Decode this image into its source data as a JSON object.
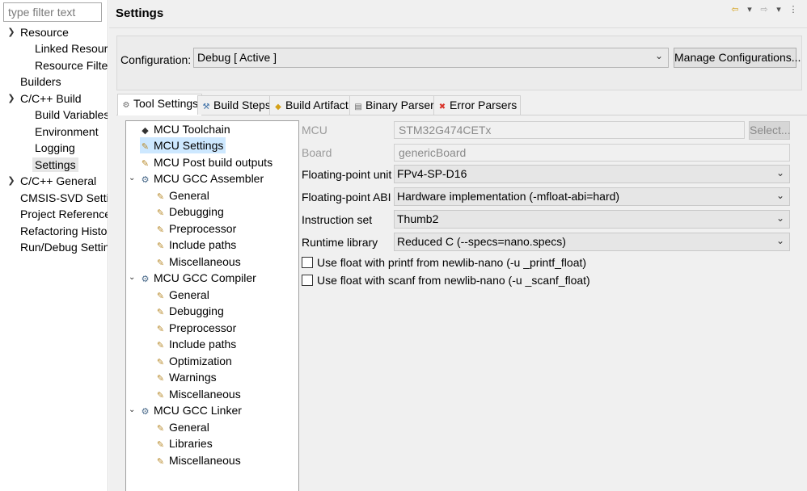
{
  "left_nav": {
    "filter_placeholder": "type filter text",
    "items": [
      {
        "label": "Resource",
        "expanded": true
      },
      {
        "label": "Linked Resources"
      },
      {
        "label": "Resource Filters"
      },
      {
        "label": "Builders"
      },
      {
        "label": "C/C++ Build",
        "expanded": true
      },
      {
        "label": "Build Variables"
      },
      {
        "label": "Environment"
      },
      {
        "label": "Logging"
      },
      {
        "label": "Settings",
        "selected": true
      },
      {
        "label": "C/C++ General",
        "expanded": false
      },
      {
        "label": "CMSIS-SVD Settings"
      },
      {
        "label": "Project References"
      },
      {
        "label": "Refactoring History"
      },
      {
        "label": "Run/Debug Settings"
      }
    ]
  },
  "header": {
    "title": "Settings",
    "toolbar_icons": [
      "back-arrow-icon",
      "dropdown-icon",
      "forward-arrow-icon",
      "dropdown-icon",
      "view-menu-icon"
    ]
  },
  "configuration": {
    "label": "Configuration:",
    "value": "Debug  [ Active ]",
    "manage_label": "Manage Configurations..."
  },
  "tabs": [
    {
      "label": "Tool Settings",
      "icon": "tool-settings-icon",
      "active": true
    },
    {
      "label": "Build Steps",
      "icon": "build-steps-icon"
    },
    {
      "label": "Build Artifact",
      "icon": "build-artifact-icon"
    },
    {
      "label": "Binary Parsers",
      "icon": "binary-parsers-icon"
    },
    {
      "label": "Error Parsers",
      "icon": "error-parsers-icon"
    }
  ],
  "tree": [
    {
      "label": "MCU Toolchain",
      "level": 0
    },
    {
      "label": "MCU Settings",
      "level": 0,
      "selected": true
    },
    {
      "label": "MCU Post build outputs",
      "level": 0
    },
    {
      "label": "MCU GCC Assembler",
      "level": 0,
      "expanded": true
    },
    {
      "label": "General",
      "level": 1
    },
    {
      "label": "Debugging",
      "level": 1
    },
    {
      "label": "Preprocessor",
      "level": 1
    },
    {
      "label": "Include paths",
      "level": 1
    },
    {
      "label": "Miscellaneous",
      "level": 1
    },
    {
      "label": "MCU GCC Compiler",
      "level": 0,
      "expanded": true
    },
    {
      "label": "General",
      "level": 1
    },
    {
      "label": "Debugging",
      "level": 1
    },
    {
      "label": "Preprocessor",
      "level": 1
    },
    {
      "label": "Include paths",
      "level": 1
    },
    {
      "label": "Optimization",
      "level": 1
    },
    {
      "label": "Warnings",
      "level": 1
    },
    {
      "label": "Miscellaneous",
      "level": 1
    },
    {
      "label": "MCU GCC Linker",
      "level": 0,
      "expanded": true
    },
    {
      "label": "General",
      "level": 1
    },
    {
      "label": "Libraries",
      "level": 1
    },
    {
      "label": "Miscellaneous",
      "level": 1
    }
  ],
  "form": {
    "mcu_label": "MCU",
    "mcu_value": "STM32G474CETx",
    "select_label": "Select...",
    "board_label": "Board",
    "board_value": "genericBoard",
    "fpu_label": "Floating-point unit",
    "fpu_value": "FPv4-SP-D16",
    "fpabi_label": "Floating-point ABI",
    "fpabi_value": "Hardware implementation (-mfloat-abi=hard)",
    "iset_label": "Instruction set",
    "iset_value": "Thumb2",
    "rtlib_label": "Runtime library",
    "rtlib_value": "Reduced C (--specs=nano.specs)",
    "printf_float_label": "Use float with printf from newlib-nano (-u _printf_float)",
    "printf_float_checked": false,
    "scanf_float_label": "Use float with scanf from newlib-nano (-u _scanf_float)",
    "scanf_float_checked": false
  }
}
